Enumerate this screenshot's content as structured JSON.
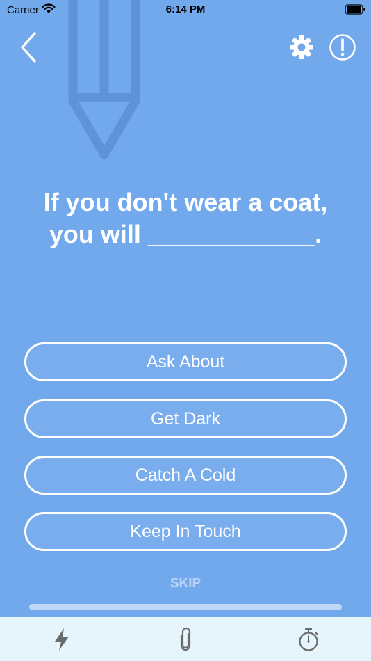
{
  "status_bar": {
    "carrier": "Carrier",
    "time": "6:14 PM",
    "icons": [
      "wifi-icon",
      "battery-icon"
    ]
  },
  "header": {
    "back_icon": "chevron-left-icon",
    "settings_icon": "gear-icon",
    "info_icon": "exclamation-circle-icon",
    "decoration_icon": "pencil-icon"
  },
  "question": {
    "line1": "If you don't wear a coat,",
    "line2": "you will ____________."
  },
  "answers": [
    {
      "label": "Ask About"
    },
    {
      "label": "Get Dark"
    },
    {
      "label": "Catch A Cold"
    },
    {
      "label": "Keep In Touch"
    }
  ],
  "skip_label": "SKIP",
  "progress": {
    "fraction": 0.0
  },
  "tab_bar": {
    "tabs": [
      {
        "icon": "lightning-icon"
      },
      {
        "icon": "paperclip-icon"
      },
      {
        "icon": "stopwatch-icon"
      }
    ]
  },
  "colors": {
    "background": "#72a8ec",
    "tab_bar": "#e6f5fb",
    "tab_icon": "#6b6b6b"
  }
}
